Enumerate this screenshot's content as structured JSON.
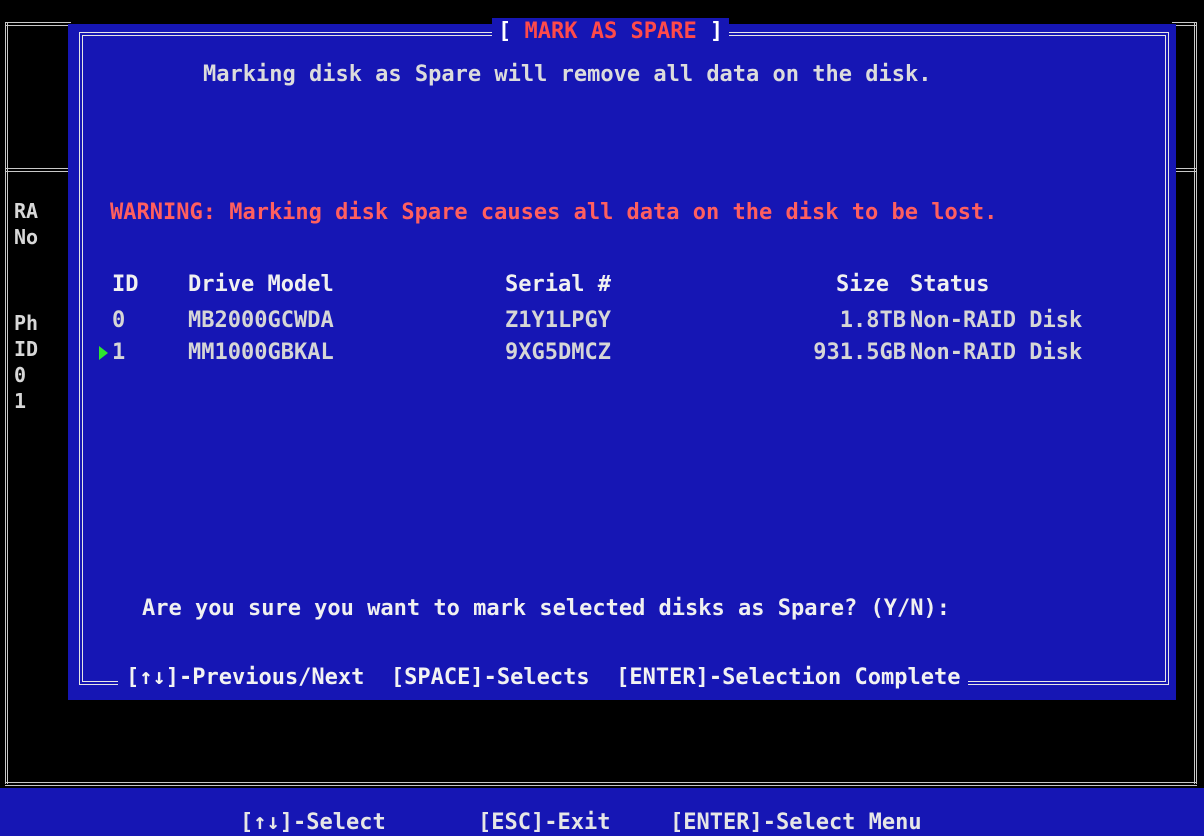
{
  "dialog": {
    "title": "MARK AS SPARE",
    "subtitle": "Marking disk as Spare will remove all data on the disk.",
    "warning": "WARNING: Marking disk Spare causes all data on the disk to be lost.",
    "columns": {
      "id": "ID",
      "model": "Drive Model",
      "serial": "Serial #",
      "size": "Size",
      "status": "Status"
    },
    "disks": [
      {
        "id": "0",
        "model": "MB2000GCWDA",
        "serial": "Z1Y1LPGY",
        "size": "1.8TB",
        "status": "Non-RAID Disk"
      },
      {
        "id": "1",
        "model": "MM1000GBKAL",
        "serial": "9XG5DMCZ",
        "size": "931.5GB",
        "status": "Non-RAID Disk"
      }
    ],
    "question": "Are you sure you want to mark selected disks as Spare? (Y/N):",
    "hints": {
      "navigate": "[↑↓]-Previous/Next",
      "select": "[SPACE]-Selects",
      "complete": "[ENTER]-Selection Complete"
    }
  },
  "background": {
    "labels": [
      "RA",
      "No",
      "Ph",
      "ID",
      "0",
      "1"
    ]
  },
  "statusbar": {
    "select": "[↑↓]-Select",
    "exit": "[ESC]-Exit",
    "menu": "[ENTER]-Select Menu"
  },
  "colors": {
    "dialog_bg": "#1616b4",
    "warning": "#ff5f5f",
    "title": "#ff4a4a",
    "pointer": "#2ee62e"
  }
}
